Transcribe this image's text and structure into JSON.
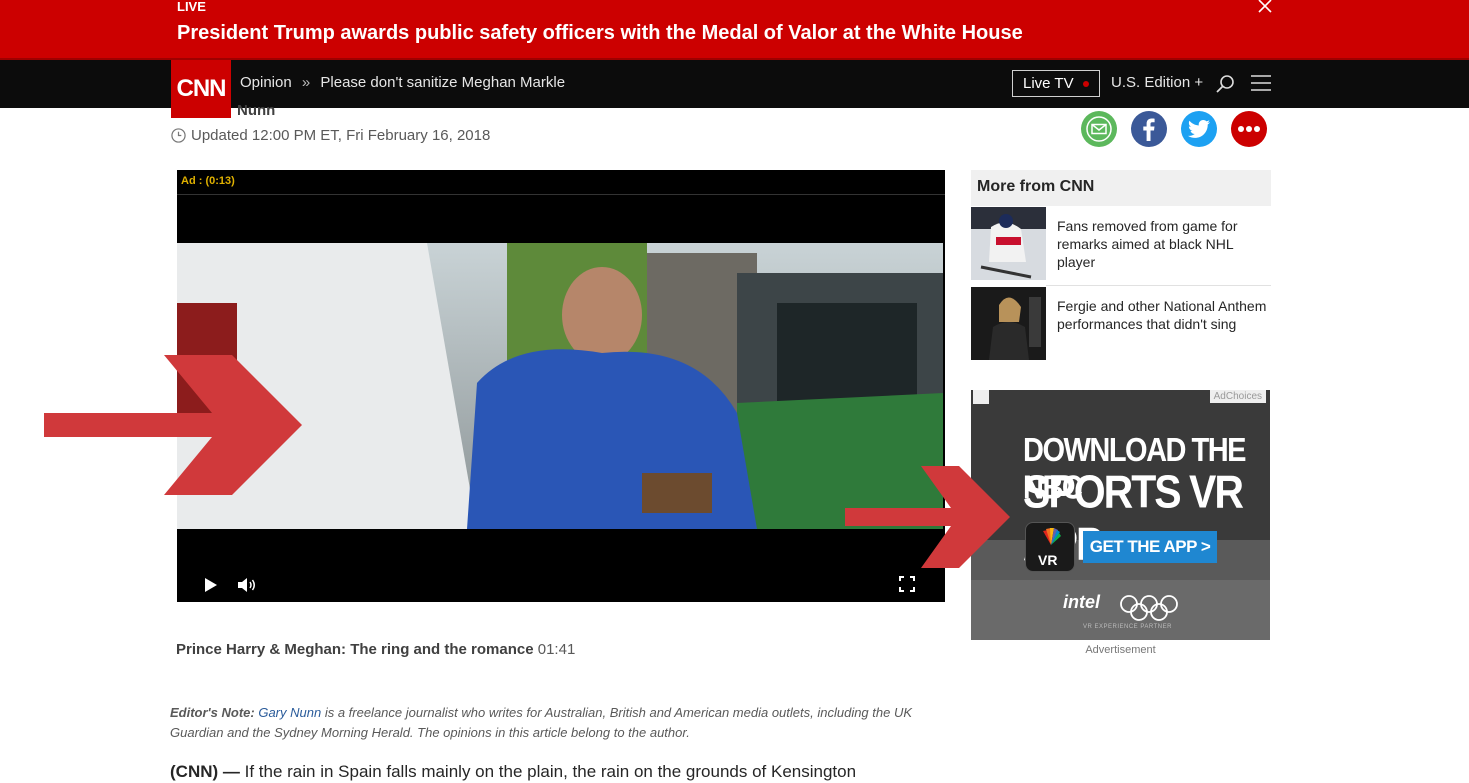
{
  "banner": {
    "live_label": "LIVE",
    "headline": "President Trump awards public safety officers with the Medal of Valor at the White House",
    "close_icon": "close-icon"
  },
  "nav": {
    "logo": "CNN",
    "section": "Opinion",
    "separator": "»",
    "article_title": "Please don't sanitize Meghan Markle",
    "live_tv": "Live TV",
    "edition": "U.S. Edition +",
    "icons": [
      "search-icon",
      "menu-icon"
    ]
  },
  "article": {
    "byline_fragment": "Nunn",
    "updated": "Updated 12:00 PM ET, Fri February 16, 2018",
    "share_icons": [
      "email-icon",
      "facebook-icon",
      "twitter-icon",
      "more-icon"
    ],
    "video": {
      "ad_countdown": "Ad : (0:13)",
      "controls": [
        "play-icon",
        "volume-icon",
        "fullscreen-icon"
      ],
      "caption": "Prince Harry & Meghan: The ring and the romance",
      "duration": "01:41"
    },
    "editors_note": {
      "label": "Editor's Note:",
      "author_link": "Gary Nunn",
      "text": " is a freelance journalist who writes for Australian, British and American media outlets, including the UK Guardian and the Sydney Morning Herald. The opinions in this article belong to the author."
    },
    "lead": {
      "dateline": "(CNN) —",
      "text": " If the rain in Spain falls mainly on the plain, the rain on the grounds of Kensington"
    }
  },
  "sidebar": {
    "more_title": "More from CNN",
    "items": [
      {
        "text": "Fans removed from game for remarks aimed at black NHL player"
      },
      {
        "text": "Fergie and other National Anthem performances that didn't sing"
      }
    ]
  },
  "ad": {
    "adchoices": "AdChoices",
    "line1": "DOWNLOAD THE NBC",
    "line2": "SPORTS VR APP",
    "cta": "GET THE APP >",
    "partner": "intel",
    "partner_sub": "VR EXPERIENCE PARTNER",
    "label": "Advertisement"
  },
  "colors": {
    "brand_red": "#cc0000",
    "arrow_red": "#d0393b",
    "link_blue": "#2a5b9a",
    "cta_blue": "#1f87d1"
  }
}
